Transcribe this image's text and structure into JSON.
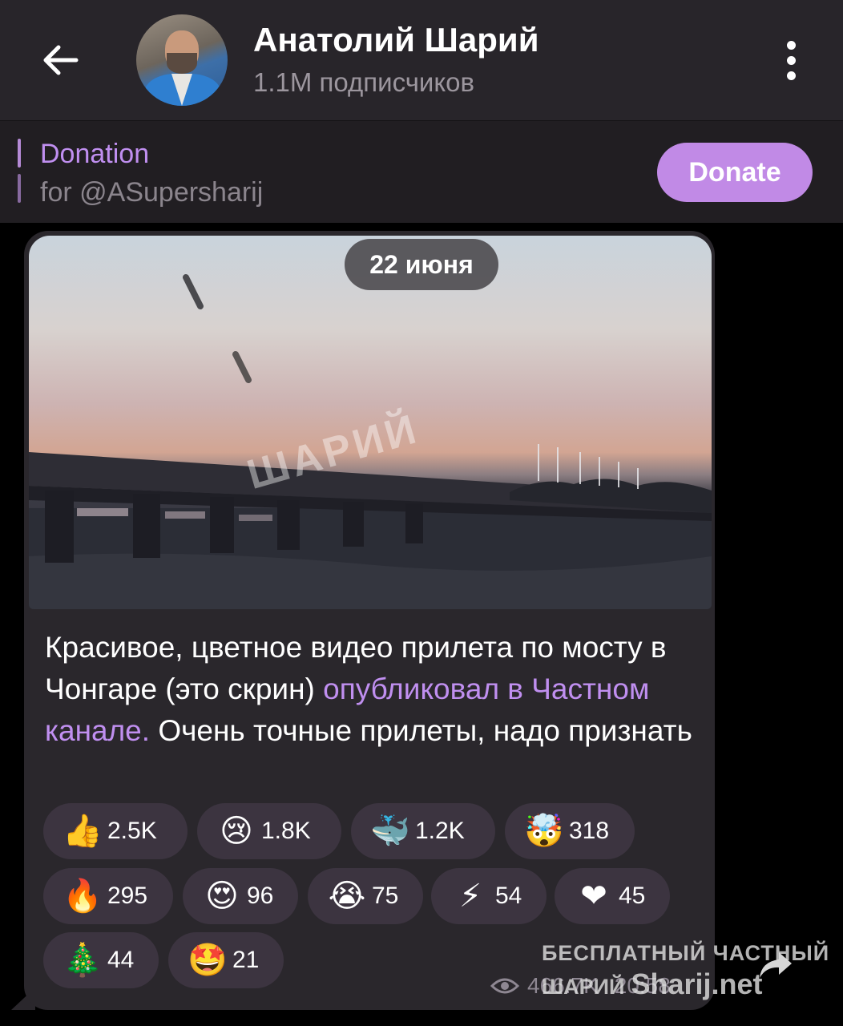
{
  "header": {
    "channel_name": "Анатолий Шарий",
    "subscribers": "1.1M подписчиков"
  },
  "pinned": {
    "title": "Donation",
    "subtitle": "for @ASupersharij",
    "button_label": "Donate",
    "accent": "#c18ae6"
  },
  "message": {
    "date": "22 июня",
    "media_watermark": "ШАРИЙ",
    "text_before_link": "Красивое, цветное видео прилета по мосту в Чонгаре (это скрин) ",
    "link_text": "опубликовал в Частном канале.",
    "text_after_link": "  Очень точные прилеты, надо признать",
    "views": "466.7K",
    "time": "20:58"
  },
  "reactions": [
    {
      "emoji": "👍",
      "icon": "thumbs-up-icon",
      "count": "2.5K"
    },
    {
      "emoji": "😢",
      "icon": "crying-face-icon",
      "count": "1.8K"
    },
    {
      "emoji": "🐳",
      "icon": "whale-icon",
      "count": "1.2K"
    },
    {
      "emoji": "🤯",
      "icon": "exploding-head-icon",
      "count": "318"
    },
    {
      "emoji": "🔥",
      "icon": "fire-icon",
      "count": "295"
    },
    {
      "emoji": "😍",
      "icon": "heart-eyes-icon",
      "count": "96"
    },
    {
      "emoji": "😭",
      "icon": "sobbing-face-icon",
      "count": "75"
    },
    {
      "emoji": "⚡",
      "icon": "lightning-icon",
      "count": "54"
    },
    {
      "emoji": "❤",
      "icon": "heart-icon",
      "count": "45"
    },
    {
      "emoji": "🎄",
      "icon": "christmas-tree-icon",
      "count": "44"
    },
    {
      "emoji": "🤩",
      "icon": "star-struck-icon",
      "count": "21"
    }
  ],
  "site_watermark": {
    "line1": "БЕСПЛАТНЫЙ ЧАСТНЫЙ",
    "line2_small": "ШАРИЙ",
    "line2_big": "Sharij.net"
  }
}
